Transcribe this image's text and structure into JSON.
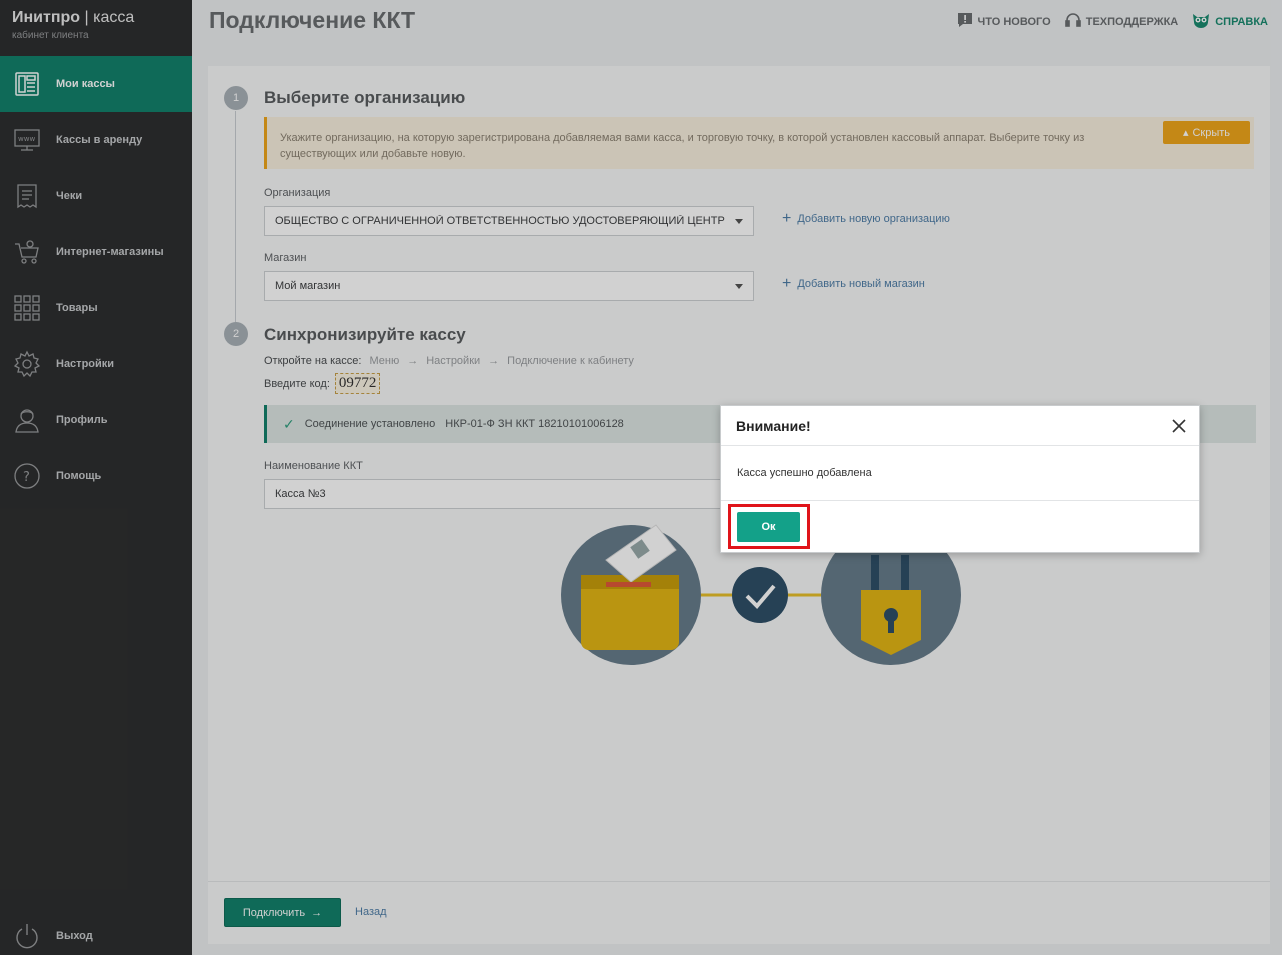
{
  "brand": {
    "name": "Инитпро",
    "sep": "|",
    "product": "касса",
    "subtitle": "кабинет клиента"
  },
  "sidebar": {
    "items": [
      {
        "label": "Мои кассы",
        "icon": "cash-register-icon",
        "active": true
      },
      {
        "label": "Кассы в аренду",
        "icon": "www-monitor-icon"
      },
      {
        "label": "Чеки",
        "icon": "receipt-icon"
      },
      {
        "label": "Интернет-магазины",
        "icon": "shopping-cart-icon"
      },
      {
        "label": "Товары",
        "icon": "grid-icon"
      },
      {
        "label": "Настройки",
        "icon": "gear-icon"
      },
      {
        "label": "Профиль",
        "icon": "user-icon"
      },
      {
        "label": "Помощь",
        "icon": "question-icon"
      }
    ],
    "logout": "Выход"
  },
  "header": {
    "title": "Подключение ККТ",
    "whats_new": "ЧТО НОВОГО",
    "support": "ТЕХПОДДЕРЖКА",
    "help": "СПРАВКА"
  },
  "step1": {
    "number": "1",
    "title": "Выберите организацию",
    "notice": "Укажите организацию, на которую зарегистрирована добавляемая вами касса, и торговую точку, в которой установлен кассовый аппарат. Выберите точку из существующих или добавьте новую.",
    "hide_label": "Скрыть",
    "org_label": "Организация",
    "org_value": "ОБЩЕСТВО С ОГРАНИЧЕННОЙ ОТВЕТСТВЕННОСТЬЮ УДОСТОВЕРЯЮЩИЙ ЦЕНТР",
    "add_org": "Добавить новую организацию",
    "shop_label": "Магазин",
    "shop_value": "Мой магазин",
    "add_shop": "Добавить новый магазин"
  },
  "step2": {
    "number": "2",
    "title": "Синхронизируйте кассу",
    "path_prefix": "Откройте на кассе:",
    "path": [
      "Меню",
      "Настройки",
      "Подключение к кабинету"
    ],
    "code_label": "Введите код:",
    "code": "09772",
    "conn_status": "Соединение установлено",
    "conn_device": "НКР-01-Ф ЗН ККТ 18210101006128",
    "name_label": "Наименование ККТ",
    "name_value": "Касса №3"
  },
  "footer": {
    "connect": "Подключить",
    "back": "Назад"
  },
  "modal": {
    "title": "Внимание!",
    "message": "Касса успешно добавлена",
    "ok": "Ок"
  },
  "colors": {
    "accent": "#13826c",
    "warning": "#f0a61c",
    "highlight": "#e0141a",
    "sidebar": "#2e2f30"
  }
}
